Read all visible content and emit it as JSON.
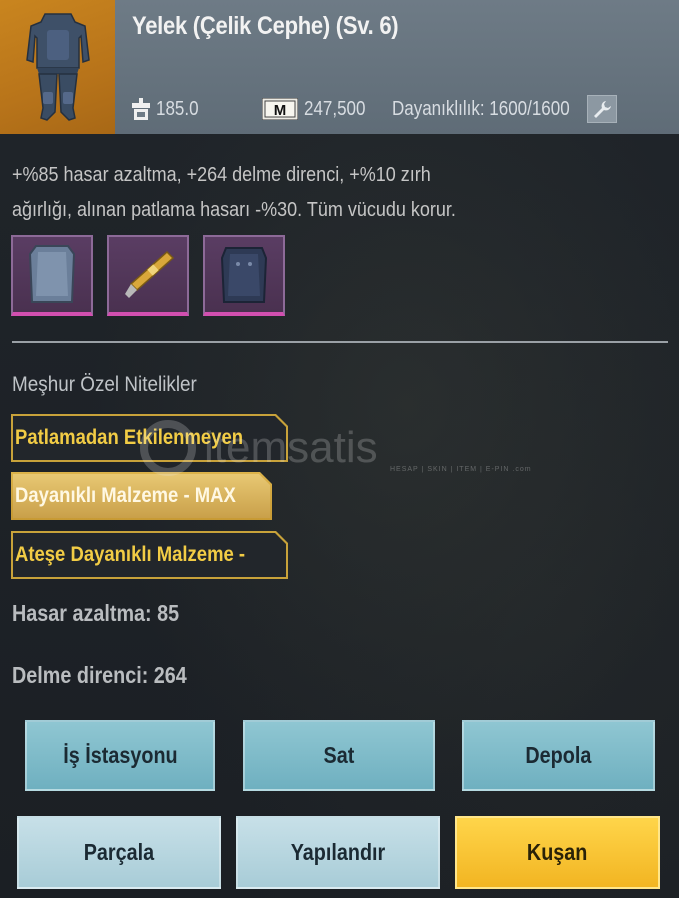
{
  "item": {
    "title": "Yelek (Çelik Cephe) (Sv. 6)",
    "weight": "185.0",
    "price": "247,500",
    "durability": "Dayanıklılık: 1600/1600",
    "money_icon_label": "M"
  },
  "description": {
    "line1": "+%85 hasar azaltma, +264 delme direnci, +%10 zırh",
    "line2": "ağırlığı, alınan patlama hasarı -%30. Tüm vücudu korur."
  },
  "parts": [
    {
      "icon": "armor-plate-icon"
    },
    {
      "icon": "strap-icon"
    },
    {
      "icon": "armor-pad-icon"
    }
  ],
  "traits": {
    "section_title": "Meşhur Özel Nitelikler",
    "items": [
      {
        "label": "Patlamadan Etkilenmeyen",
        "style": "outline"
      },
      {
        "label": "Dayanıklı Malzeme - MAX",
        "style": "filled"
      },
      {
        "label": "Ateşe Dayanıklı Malzeme -",
        "style": "outline"
      }
    ]
  },
  "info": {
    "damage_reduction": "Hasar azaltma: 85",
    "penetration_resistance": "Delme direnci: 264"
  },
  "buttons": {
    "workstation": "İş İstasyonu",
    "sell": "Sat",
    "store": "Depola",
    "dismantle": "Parçala",
    "configure": "Yapılandır",
    "equip": "Kuşan"
  },
  "watermark": {
    "text": "itemsatis",
    "sub": "HESAP | SKIN | ITEM | E-PIN .com"
  },
  "colors": {
    "header_bg": "#6e7b86",
    "thumb_bg": "#c9851f",
    "trait_gold": "#f2cc45",
    "button_teal": "#7fbccb",
    "button_gold": "#f7c533"
  }
}
